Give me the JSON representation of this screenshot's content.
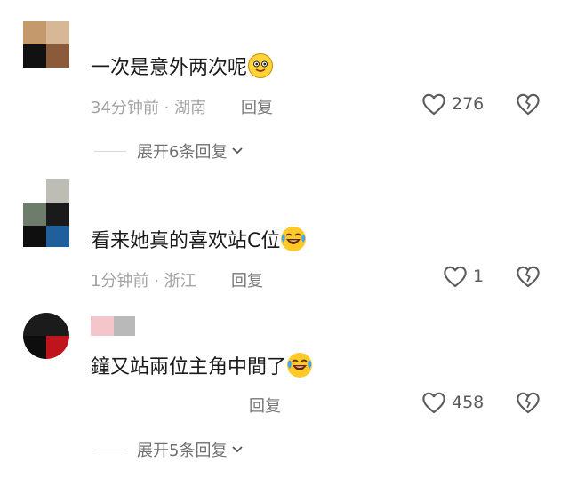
{
  "comments": [
    {
      "text": "一次是意外两次呢",
      "emoji": "smiling-face-emoji",
      "time": "34分钟前",
      "location": "湖南",
      "reply_label": "回复",
      "likes": "276",
      "expand_label": "展开6条回复",
      "avatar_colors": [
        "#c49a6c",
        "#d6b896",
        "#111111",
        "#8a5a3a"
      ]
    },
    {
      "text": "看来她真的喜欢站C位",
      "emoji": "crying-laughing-emoji",
      "time": "1分钟前",
      "location": "浙江",
      "reply_label": "回复",
      "likes": "1",
      "avatar_colors": [
        "#bdbdb6",
        "#6d7c6b",
        "#1a1a1a",
        "#0f0f0f",
        "#1f5f9c"
      ]
    },
    {
      "text": "鐘又站兩位主角中間了",
      "emoji": "crying-laughing-emoji",
      "reply_label": "回复",
      "likes": "458",
      "expand_label": "展开5条回复",
      "avatar_colors": [
        "#1b1b1b",
        "#0d0d0d",
        "#c0141c"
      ],
      "name_blur_colors": [
        "#f4c6cb",
        "#b9b9b9"
      ]
    }
  ],
  "colors": {
    "meta": "#a3a3a3",
    "icon": "#5b5b5b",
    "emoji": "#ffd43b"
  }
}
